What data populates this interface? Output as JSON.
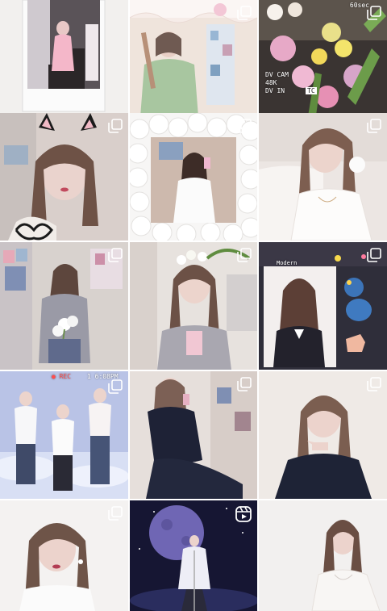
{
  "feed": {
    "posts": [
      {
        "id": "p1",
        "kind": "single",
        "overlay": []
      },
      {
        "id": "p2",
        "kind": "multi",
        "overlay": []
      },
      {
        "id": "p3",
        "kind": "multi",
        "overlay": [
          "60sec",
          "DV CAM",
          "48K",
          "DV IN",
          "TC"
        ]
      },
      {
        "id": "p4",
        "kind": "multi",
        "overlay": []
      },
      {
        "id": "p5",
        "kind": "multi",
        "overlay": []
      },
      {
        "id": "p6",
        "kind": "multi",
        "overlay": []
      },
      {
        "id": "p7",
        "kind": "multi",
        "overlay": []
      },
      {
        "id": "p8",
        "kind": "multi",
        "overlay": []
      },
      {
        "id": "p9",
        "kind": "multi",
        "overlay": [
          "Modern"
        ]
      },
      {
        "id": "p10",
        "kind": "multi",
        "overlay": [
          "● REC",
          "1 6:08PM"
        ]
      },
      {
        "id": "p11",
        "kind": "multi",
        "overlay": []
      },
      {
        "id": "p12",
        "kind": "multi",
        "overlay": []
      },
      {
        "id": "p13",
        "kind": "multi",
        "overlay": []
      },
      {
        "id": "p14",
        "kind": "reel",
        "overlay": []
      },
      {
        "id": "p15",
        "kind": "none",
        "overlay": []
      }
    ]
  },
  "icons": {
    "multi": "carousel-icon",
    "reel": "reels-icon"
  }
}
